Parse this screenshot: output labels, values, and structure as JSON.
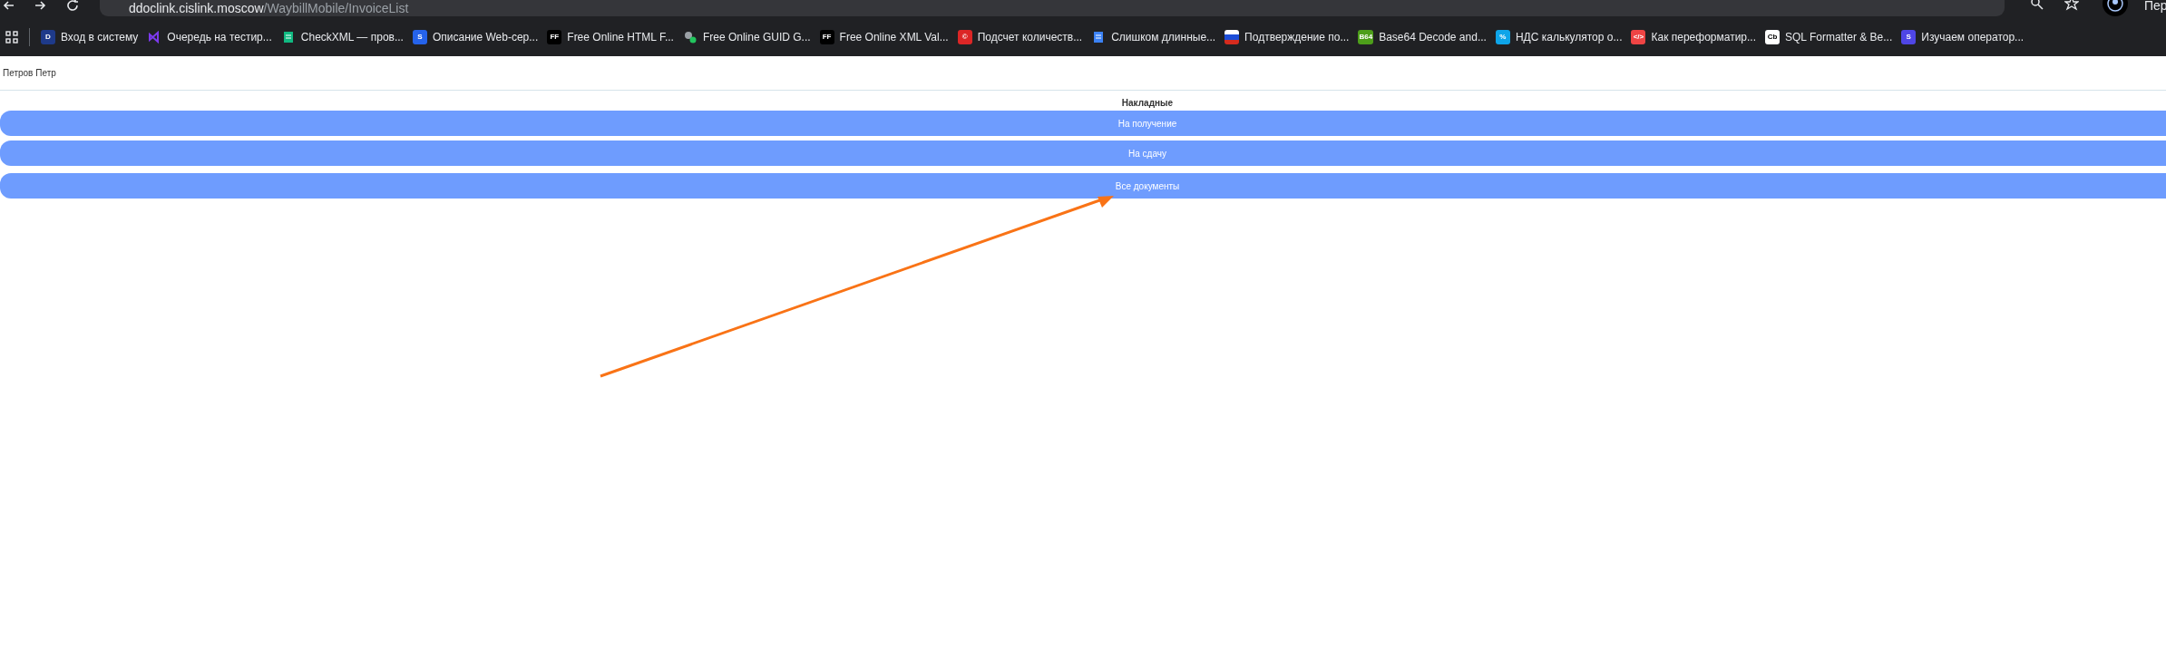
{
  "browser": {
    "address": {
      "host": "ddoclink.cislink.moscow",
      "path": "/WaybillMobile/InvoiceList"
    },
    "profile_label": "Пер",
    "bookmarks": [
      {
        "label": "Вход в систему",
        "kind": "glyph",
        "icon_text": "D",
        "color": "#1e3a8a"
      },
      {
        "label": "Очередь на тестир...",
        "kind": "vs",
        "color": "#7c3aed"
      },
      {
        "label": "CheckXML — пров...",
        "kind": "doc",
        "color": "#10b981"
      },
      {
        "label": "Описание Web-сер...",
        "kind": "glyph",
        "icon_text": "S",
        "color": "#2563eb"
      },
      {
        "label": "Free Online HTML F...",
        "kind": "glyph",
        "icon_text": "FF",
        "color": "#000000"
      },
      {
        "label": "Free Online GUID G...",
        "kind": "gear",
        "color": "#22c55e"
      },
      {
        "label": "Free Online XML Val...",
        "kind": "glyph",
        "icon_text": "FF",
        "color": "#000000"
      },
      {
        "label": "Подсчет количеств...",
        "kind": "glyph",
        "icon_text": "©",
        "color": "#dc2626"
      },
      {
        "label": "Слишком длинные...",
        "kind": "doc",
        "color": "#3b82f6"
      },
      {
        "label": "Подтверждение по...",
        "kind": "flag",
        "color": "#1d4ed8"
      },
      {
        "label": "Base64 Decode and...",
        "kind": "glyph",
        "icon_text": "B64",
        "color": "#4d9e1a"
      },
      {
        "label": "НДС калькулятор о...",
        "kind": "glyph",
        "icon_text": "%",
        "color": "#0ea5e9"
      },
      {
        "label": "Как переформатир...",
        "kind": "glyph",
        "icon_text": "</>",
        "color": "#ef4444"
      },
      {
        "label": "SQL Formatter & Be...",
        "kind": "glyph",
        "icon_text": "Cb",
        "color": "#ffffff"
      },
      {
        "label": "Изучаем оператор...",
        "kind": "glyph",
        "icon_text": "S",
        "color": "#4f46e5"
      }
    ]
  },
  "page": {
    "user": "Петров Петр",
    "title": "Накладные",
    "buttons": [
      "На получение",
      "На сдачу",
      "Все документы"
    ]
  }
}
